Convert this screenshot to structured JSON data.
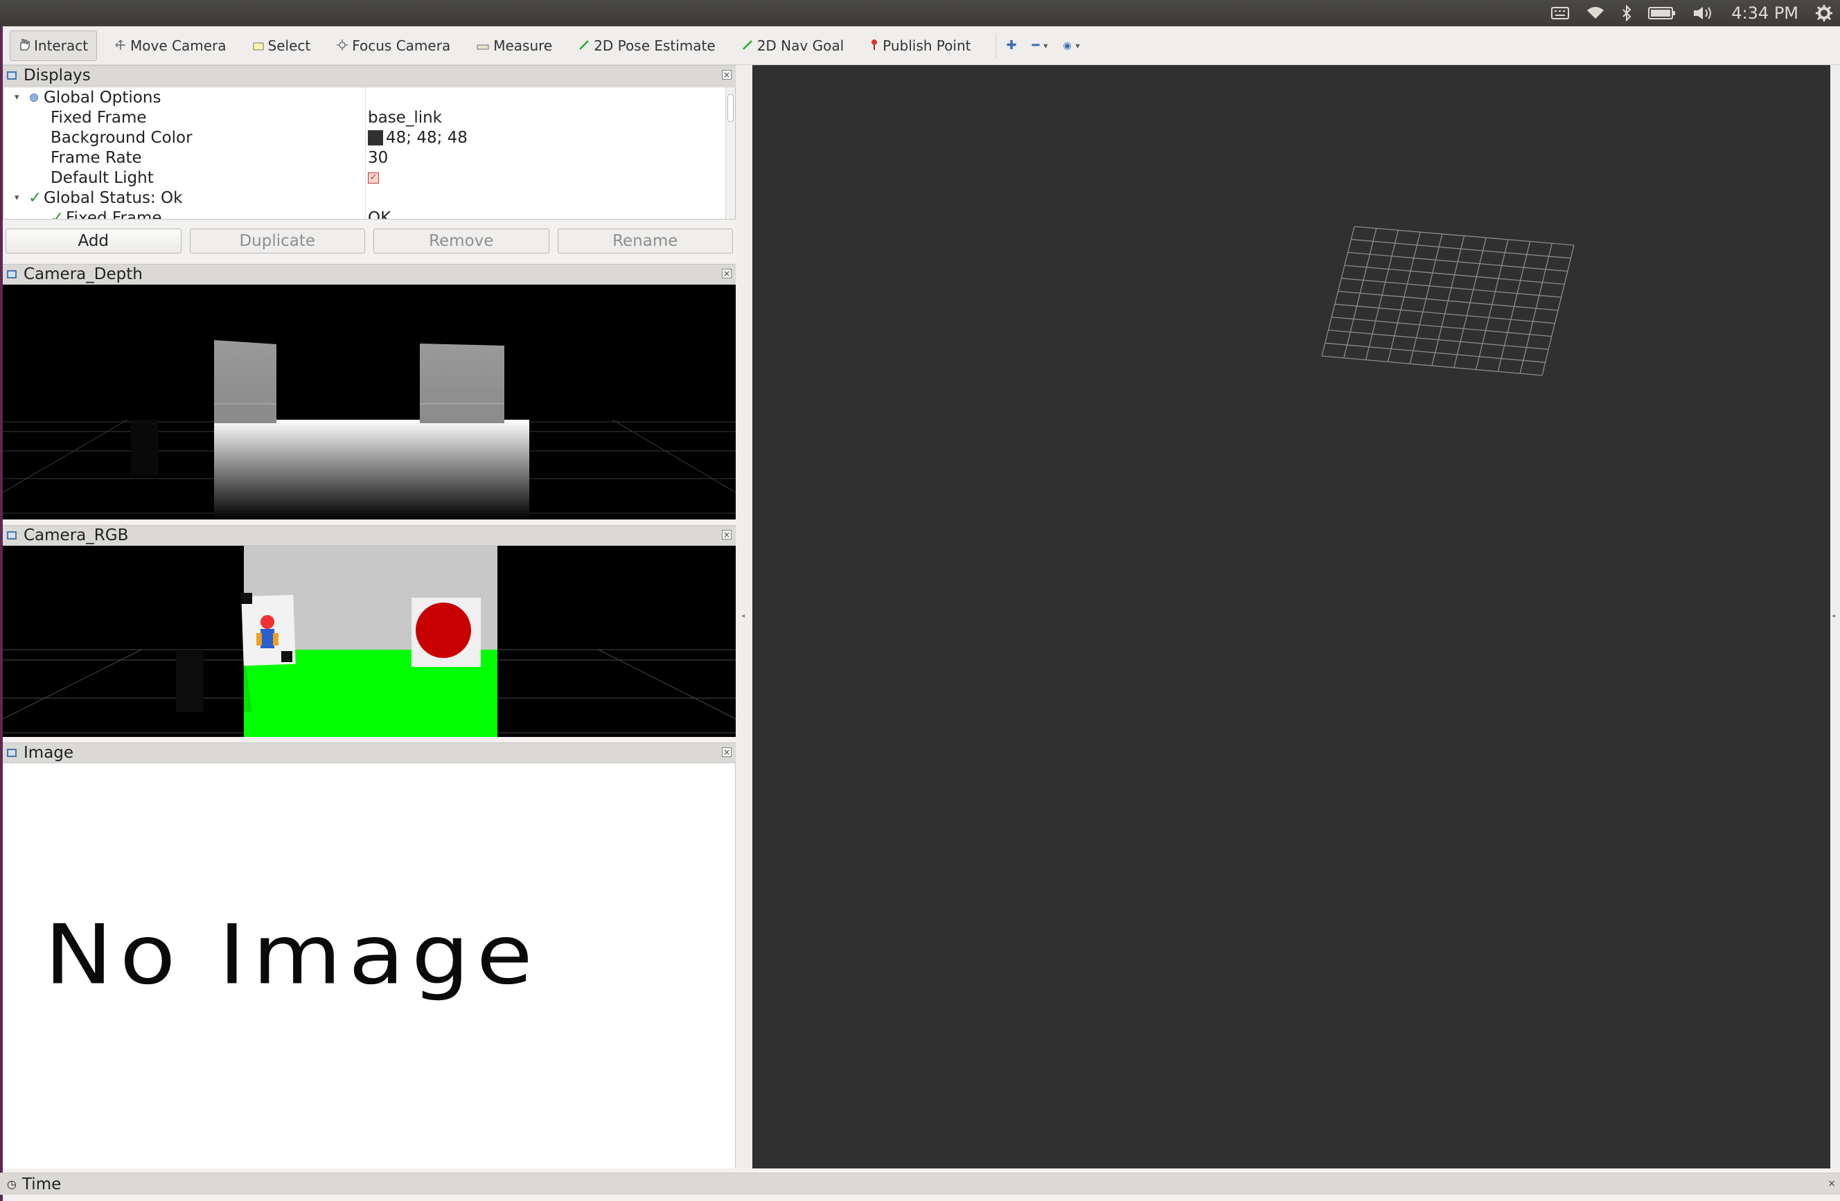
{
  "system": {
    "time": "4:34 PM",
    "icons": [
      "keyboard-icon",
      "wifi-icon",
      "bluetooth-icon",
      "battery-icon",
      "volume-icon",
      "settings-icon"
    ]
  },
  "toolbar": {
    "tools": [
      {
        "label": "Interact",
        "icon": "hand-icon",
        "active": true
      },
      {
        "label": "Move Camera",
        "icon": "move-camera-icon",
        "active": false
      },
      {
        "label": "Select",
        "icon": "select-icon",
        "active": false
      },
      {
        "label": "Focus Camera",
        "icon": "focus-icon",
        "active": false
      },
      {
        "label": "Measure",
        "icon": "ruler-icon",
        "active": false
      },
      {
        "label": "2D Pose Estimate",
        "icon": "pose-arrow-icon",
        "active": false
      },
      {
        "label": "2D Nav Goal",
        "icon": "nav-arrow-icon",
        "active": false
      },
      {
        "label": "Publish Point",
        "icon": "pin-icon",
        "active": false
      }
    ]
  },
  "displays": {
    "title": "Displays",
    "rows": [
      {
        "key": "Global Options",
        "value": ""
      },
      {
        "key": "Fixed Frame",
        "value": "base_link"
      },
      {
        "key": "Background Color",
        "value": "48; 48; 48"
      },
      {
        "key": "Frame Rate",
        "value": "30"
      },
      {
        "key": "Default Light",
        "value": ""
      },
      {
        "key": "Global Status: Ok",
        "value": ""
      },
      {
        "key": "Fixed Frame",
        "value": "OK"
      }
    ],
    "background_color_hex": "#303030"
  },
  "buttons": {
    "add": "Add",
    "duplicate": "Duplicate",
    "remove": "Remove",
    "rename": "Rename"
  },
  "panels": {
    "camera_depth": "Camera_Depth",
    "camera_rgb": "Camera_RGB",
    "image": "Image",
    "time": "Time"
  },
  "image_panel": {
    "placeholder": "No Image"
  },
  "colors": {
    "view_bg": "#303030",
    "rgb_floor": "#00ff00",
    "rgb_target": "#c80000"
  }
}
